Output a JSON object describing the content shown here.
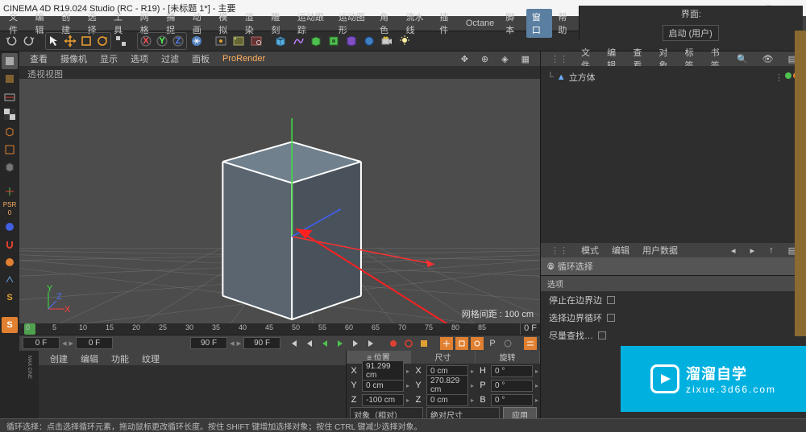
{
  "window": {
    "title": "CINEMA 4D R19.024 Studio (RC - R19) - [未标题 1*] - 主要"
  },
  "menu": {
    "items": [
      "文件",
      "编辑",
      "创建",
      "选择",
      "工具",
      "网格",
      "捕捉",
      "动画",
      "模拟",
      "渲染",
      "雕刻",
      "运动跟踪",
      "运动图形",
      "角色",
      "流水线",
      "插件",
      "Octane",
      "脚本",
      "窗口",
      "帮助"
    ],
    "highlight_index": 18,
    "right_label": "界面:",
    "right_combo": "启动 (用户)"
  },
  "viewport": {
    "tabs": [
      "查看",
      "摄像机",
      "显示",
      "选项",
      "过滤",
      "面板",
      "ProRender"
    ],
    "pro_index": 6,
    "sub": "透视视图",
    "grid_label": "网格间距 : 100 cm"
  },
  "objects": {
    "tabs": [
      "文件",
      "编辑",
      "查看",
      "对象",
      "标签",
      "书签"
    ],
    "tree": [
      {
        "name": "立方体"
      }
    ]
  },
  "attr": {
    "tabs": [
      "模式",
      "编辑",
      "用户数据"
    ],
    "header": "循环选择",
    "section": "选项",
    "rows": [
      {
        "label": "停止在边界边"
      },
      {
        "label": "选择边界循环"
      },
      {
        "label": "尽量查找…"
      }
    ]
  },
  "timeline": {
    "start": "0 F",
    "current": "0 F",
    "end": "90 F",
    "end2": "90 F",
    "lastmark": "0 F",
    "marks": [
      "0",
      "5",
      "10",
      "15",
      "20",
      "25",
      "30",
      "35",
      "40",
      "45",
      "50",
      "55",
      "60",
      "65",
      "70",
      "75",
      "80",
      "85"
    ]
  },
  "coords": {
    "tabs": [
      "位置",
      "尺寸",
      "旋转"
    ],
    "rows": [
      {
        "a": "X",
        "v1": "91.299 cm",
        "b": "X",
        "v2": "0 cm",
        "c": "H",
        "v3": "0 °"
      },
      {
        "a": "Y",
        "v1": "0 cm",
        "b": "Y",
        "v2": "270.829 cm",
        "c": "P",
        "v3": "0 °"
      },
      {
        "a": "Z",
        "v1": "-100 cm",
        "b": "Z",
        "v2": "0 cm",
        "c": "B",
        "v3": "0 °"
      }
    ],
    "combo1": "对象（相对）",
    "combo2": "绝对尺寸",
    "apply": "应用"
  },
  "bottom_tabs": [
    "创建",
    "编辑",
    "功能",
    "纹理"
  ],
  "statusbar": "循环选择：点击选择循环元素，拖动鼠标更改循环长度。按住 SHIFT 键增加选择对象；按住 CTRL 键减少选择对象。",
  "watermark": {
    "text1": "溜溜自学",
    "text2": "zixue.3d66.com"
  }
}
